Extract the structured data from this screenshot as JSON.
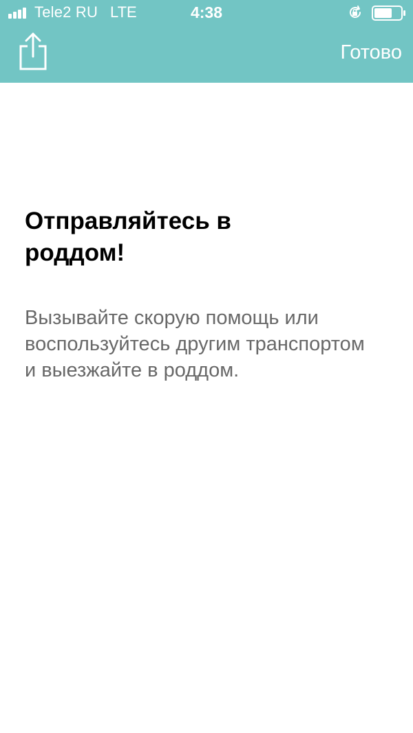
{
  "status_bar": {
    "carrier": "Tele2 RU",
    "network": "LTE",
    "time": "4:38",
    "icons": [
      "signal-bars-icon",
      "orientation-lock-icon",
      "battery-icon"
    ]
  },
  "header": {
    "share_icon": "share-icon",
    "done_label": "Готово"
  },
  "main": {
    "title": "Отправляйтесь в роддом!",
    "description": "Вызывайте скорую помощь или воспользуйтесь другим транспортом и выезжайте в роддом."
  },
  "colors": {
    "header_background": "#72c5c4",
    "title_text": "#000000",
    "body_text": "#686868"
  }
}
